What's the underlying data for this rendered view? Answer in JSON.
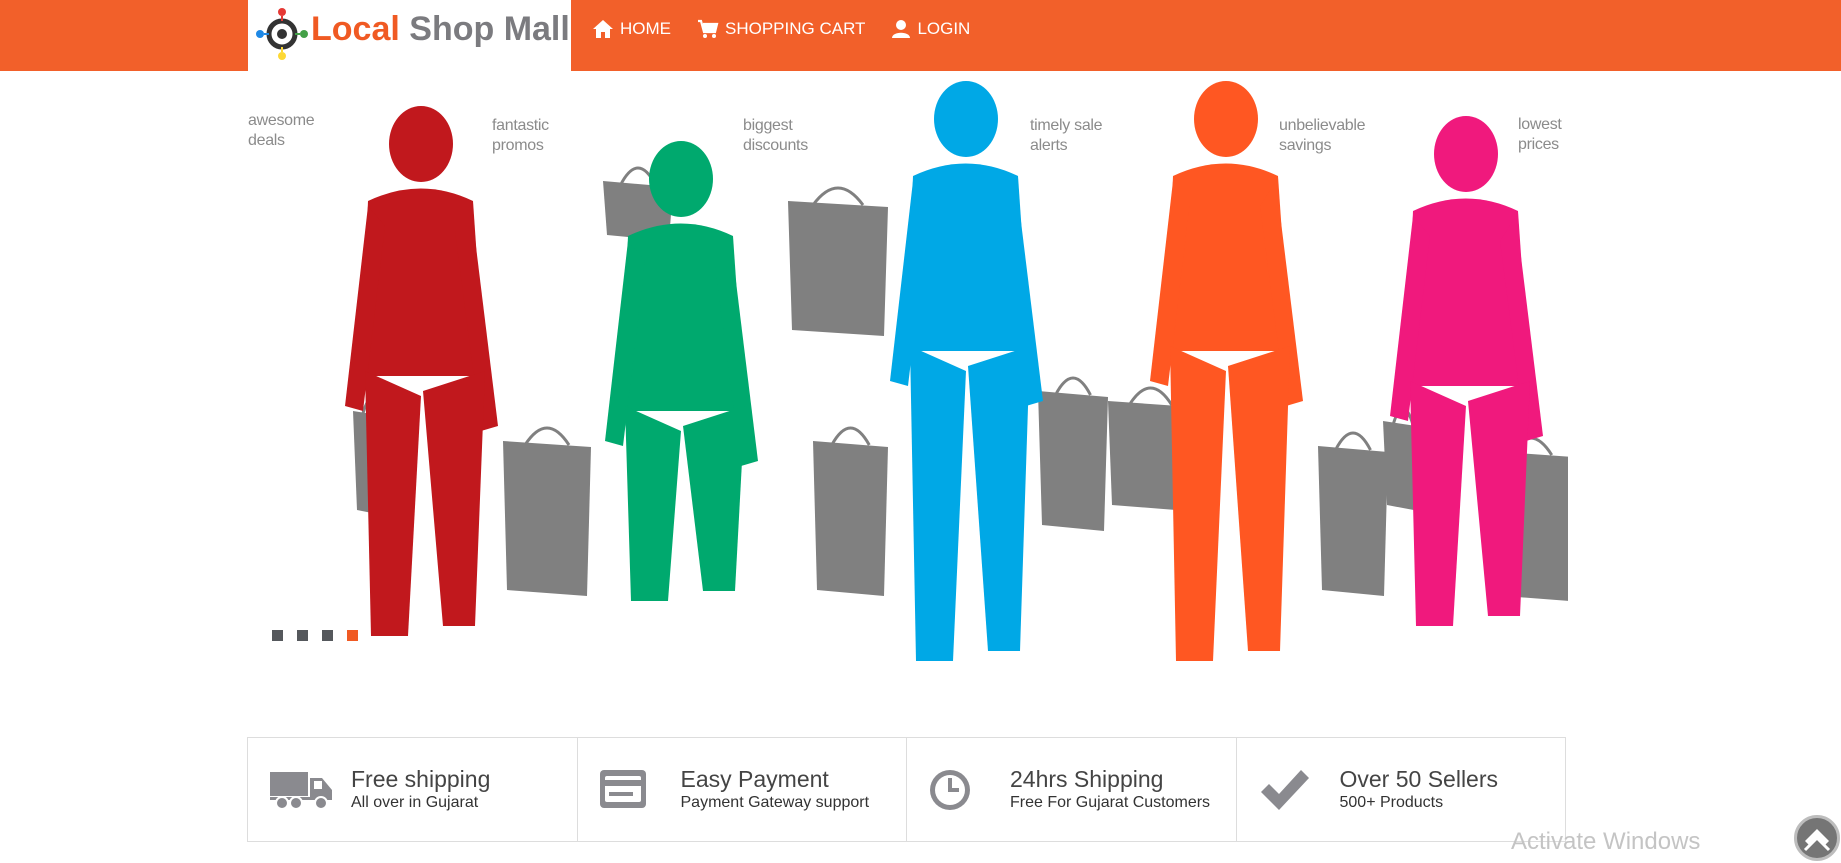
{
  "brand": {
    "word1": "Local",
    "word2": "Shop Mall",
    "primary_color": "#f2602a",
    "secondary_color": "#7b7b7f"
  },
  "nav": [
    {
      "label": "HOME",
      "icon": "home-icon"
    },
    {
      "label": "SHOPPING CART",
      "icon": "cart-icon"
    },
    {
      "label": "LOGIN",
      "icon": "user-icon"
    }
  ],
  "hero": {
    "taglines": [
      [
        "awesome",
        "deals"
      ],
      [
        "fantastic",
        "promos"
      ],
      [
        "biggest",
        "discounts"
      ],
      [
        "timely sale",
        "alerts"
      ],
      [
        "unbelievable",
        "savings"
      ],
      [
        "lowest",
        "prices"
      ]
    ],
    "figure_colors": [
      "#c1181d",
      "#00a96e",
      "#00a8e6",
      "#ff5722",
      "#f0197d"
    ],
    "bag_color": "#808080",
    "slides": 4,
    "active_slide": 4
  },
  "features": [
    {
      "title": "Free shipping",
      "subtitle": "All over in Gujarat",
      "icon": "truck-icon"
    },
    {
      "title": "Easy Payment",
      "subtitle": "Payment Gateway support",
      "icon": "credit-card-icon"
    },
    {
      "title": "24hrs Shipping",
      "subtitle": "Free For Gujarat Customers",
      "icon": "clock-icon"
    },
    {
      "title": "Over 50 Sellers",
      "subtitle": "500+ Products",
      "icon": "checkmark-icon"
    }
  ],
  "watermark": "Activate Windows"
}
